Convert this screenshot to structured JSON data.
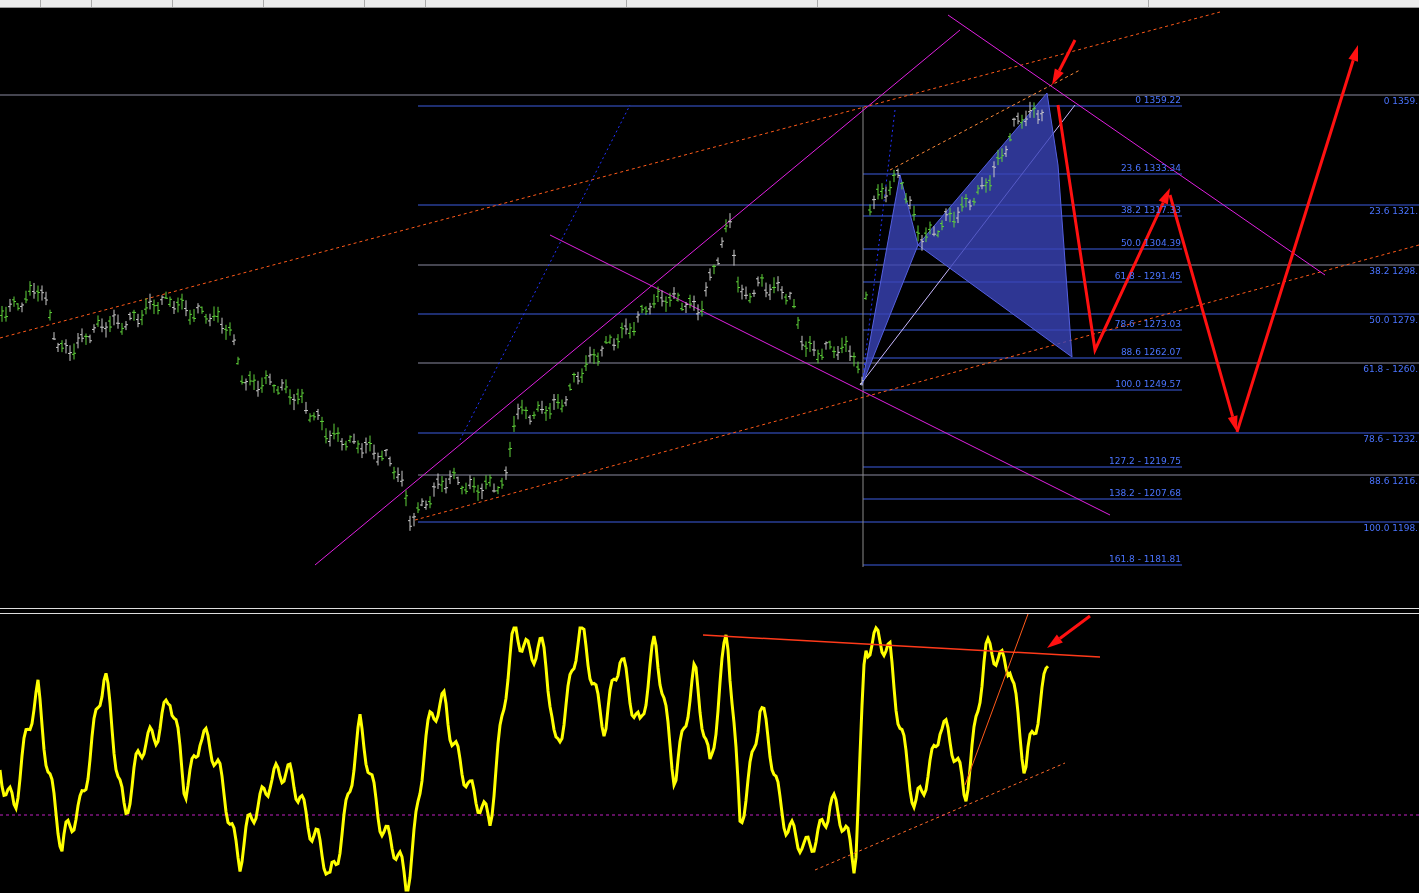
{
  "chart": {
    "fib_left": [
      {
        "label": "0 1359.22"
      },
      {
        "label": "23.6 1333.34"
      },
      {
        "label": "38.2 1317.33"
      },
      {
        "label": "50.0 1304.39"
      },
      {
        "label": "61.8 - 1291.45"
      },
      {
        "label": "78.6 - 1273.03"
      },
      {
        "label": "88.6 1262.07"
      },
      {
        "label": "100.0 1249.57"
      },
      {
        "label": "127.2 - 1219.75"
      },
      {
        "label": "138.2 - 1207.68"
      },
      {
        "label": "161.8 -  1181.81"
      }
    ],
    "fib_right": [
      {
        "label": "0 1359."
      },
      {
        "label": "23.6 1321."
      },
      {
        "label": "38.2 1298."
      },
      {
        "label": "50.0 1279."
      },
      {
        "label": "61.8 - 1260."
      },
      {
        "label": "78.6 - 1232."
      },
      {
        "label": "88.6 1216."
      },
      {
        "label": "100.0 1198."
      }
    ]
  }
}
